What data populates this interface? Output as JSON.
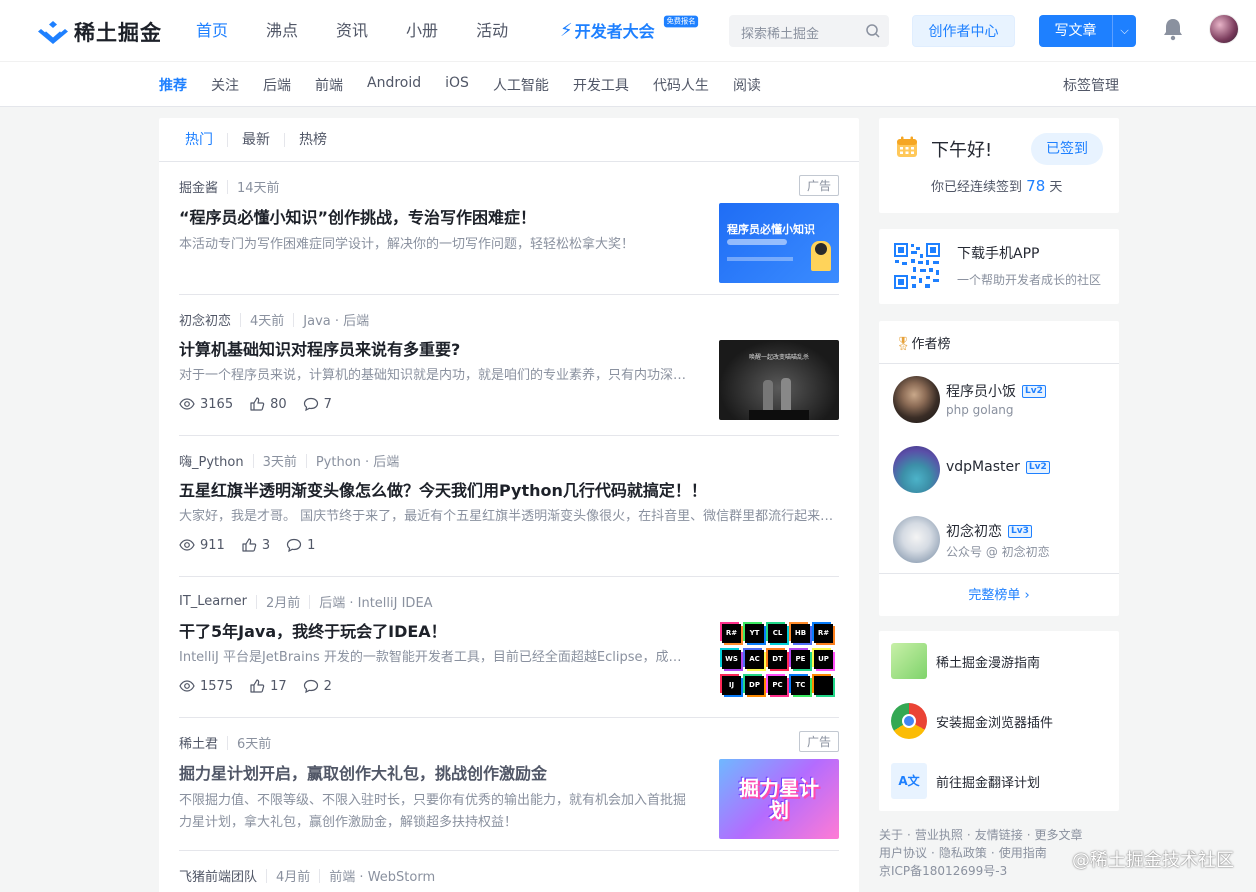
{
  "header": {
    "logo_text": "稀土掘金",
    "nav": [
      "首页",
      "沸点",
      "资讯",
      "小册",
      "活动"
    ],
    "conference": "开发者大会",
    "conference_tag": "免费报名",
    "search_placeholder": "探索稀土掘金",
    "creator_center": "创作者中心",
    "write_article": "写文章"
  },
  "subnav": {
    "items": [
      "推荐",
      "关注",
      "后端",
      "前端",
      "Android",
      "iOS",
      "人工智能",
      "开发工具",
      "代码人生",
      "阅读"
    ],
    "manage": "标签管理"
  },
  "feed": {
    "tabs": [
      "热门",
      "最新",
      "热榜"
    ],
    "entries": [
      {
        "author": "掘金酱",
        "date": "14天前",
        "tags": "",
        "ad": "广告",
        "title": "“程序员必懂小知识”创作挑战，专治写作困难症！",
        "abstract": "本活动专门为写作困难症同学设计，解决你的一切写作问题，轻轻松松拿大奖！",
        "views": "",
        "likes": "",
        "comments": "",
        "thumb_text": "程序员必懂小知识"
      },
      {
        "author": "初念初恋",
        "date": "4天前",
        "tags": "Java · 后端",
        "ad": "",
        "title": "计算机基础知识对程序员来说有多重要?",
        "abstract": "对于一个程序员来说，计算机的基础知识就是内功，就是咱们的专业素养，只有内功深厚，才能在技术这条路上走得更远。",
        "views": "3165",
        "likes": "80",
        "comments": "7",
        "thumb_text": "唤醒一起改变喵喵乱杀"
      },
      {
        "author": "嗨_Python",
        "date": "3天前",
        "tags": "Python · 后端",
        "ad": "",
        "title": "五星红旗半透明渐变头像怎么做？今天我们用Python几行代码就搞定！！",
        "abstract": "大家好，我是才哥。 国庆节终于来了，最近有个五星红旗半透明渐变头像很火，在抖音里、微信群里都流行起来了。",
        "views": "911",
        "likes": "3",
        "comments": "1",
        "thumb_text": ""
      },
      {
        "author": "IT_Learner",
        "date": "2月前",
        "tags": "后端 · IntelliJ IDEA",
        "ad": "",
        "title": "干了5年Java，我终于玩会了IDEA！",
        "abstract": "IntelliJ 平台是JetBrains 开发的一款智能开发者工具，目前已经全面超越Eclipse，成为Java开发者的首选。",
        "views": "1575",
        "likes": "17",
        "comments": "2",
        "thumb_text": ""
      },
      {
        "author": "稀土君",
        "date": "6天前",
        "tags": "",
        "ad": "广告",
        "title": "掘力星计划开启，赢取创作大礼包，挑战创作激励金",
        "abstract": "不限掘力值、不限等级、不限入驻时长，只要你有优秀的输出能力，就有机会加入首批掘力星计划，拿大礼包，赢创作激励金，解锁超多扶持权益！",
        "views": "",
        "likes": "",
        "comments": "",
        "thumb_text": "掘力星计划"
      },
      {
        "author": "飞猪前端团队",
        "date": "4月前",
        "tags": "前端 · WebStorm",
        "ad": "",
        "title": "",
        "abstract": "",
        "views": "",
        "likes": "",
        "comments": "",
        "thumb_text": ""
      }
    ],
    "jb_icons": [
      "R#",
      "YT",
      "CL",
      "HB",
      "R#",
      "WS",
      "AC",
      "DT",
      "PE",
      "UP",
      "IJ",
      "DP",
      "PC",
      "TC",
      ""
    ]
  },
  "sidebar": {
    "greeting": "下午好!",
    "signed_label": "已签到",
    "streak_prefix": "你已经连续签到",
    "streak_days": "78",
    "streak_suffix": "天",
    "app_title": "下载手机APP",
    "app_sub": "一个帮助开发者成长的社区",
    "rank_title": "作者榜",
    "authors": [
      {
        "name": "程序员小饭",
        "level": "Lv2",
        "desc": "php golang"
      },
      {
        "name": "vdpMaster",
        "level": "Lv2",
        "desc": ""
      },
      {
        "name": "初念初恋",
        "level": "Lv3",
        "desc": "公众号 @ 初念初恋"
      }
    ],
    "rank_more": "完整榜单",
    "links": [
      "稀土掘金漫游指南",
      "安装掘金浏览器插件",
      "前往掘金翻译计划"
    ],
    "footer": [
      [
        "关于",
        "·",
        "营业执照",
        "·",
        "友情链接",
        "·",
        "更多文章"
      ],
      [
        "用户协议",
        "·",
        "隐私政策",
        "·",
        "使用指南"
      ],
      [
        "京ICP备18012699号-3"
      ]
    ]
  },
  "watermark": "@稀土掘金技术社区",
  "colors": {
    "accent": "#1e80ff",
    "text": "#1d2129",
    "muted": "#8a919f",
    "bg": "#f4f5f5"
  }
}
